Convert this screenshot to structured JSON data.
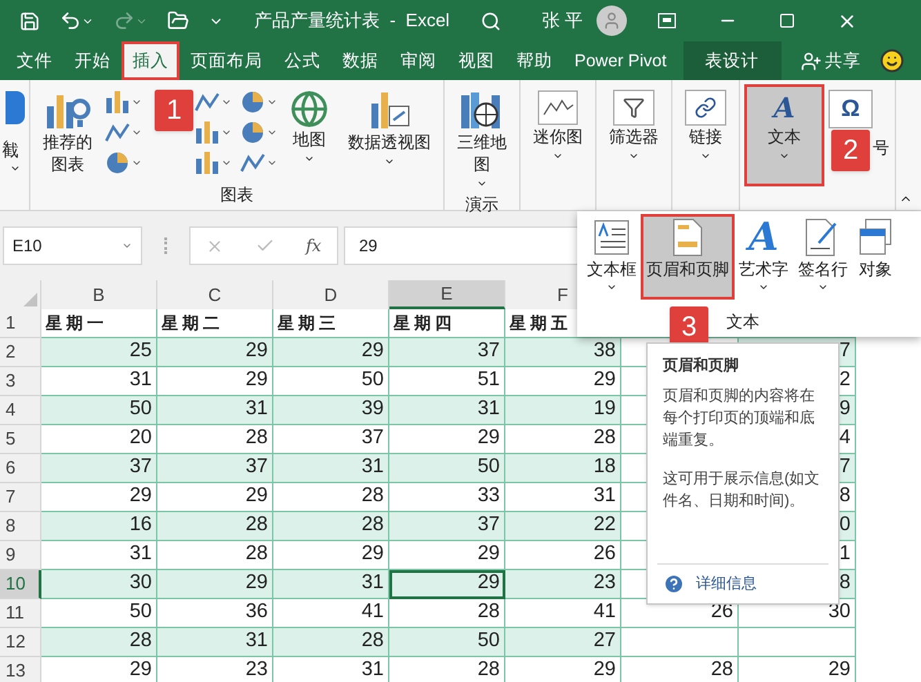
{
  "title_bar": {
    "title": "产品产量统计表  -  Excel",
    "user": "张 平",
    "quick_access": [
      {
        "kind": "save",
        "disabled": false
      },
      {
        "kind": "undo",
        "disabled": false
      },
      {
        "kind": "redo",
        "disabled": true
      },
      {
        "kind": "open",
        "disabled": false
      },
      {
        "kind": "customize",
        "disabled": false
      }
    ]
  },
  "menu_tabs": [
    {
      "label": "文件",
      "selected": false
    },
    {
      "label": "开始",
      "selected": false
    },
    {
      "label": "插入",
      "selected": true,
      "step": "1"
    },
    {
      "label": "页面布局",
      "selected": false
    },
    {
      "label": "公式",
      "selected": false
    },
    {
      "label": "数据",
      "selected": false
    },
    {
      "label": "审阅",
      "selected": false
    },
    {
      "label": "视图",
      "selected": false
    },
    {
      "label": "帮助",
      "selected": false
    },
    {
      "label": "Power Pivot",
      "selected": false
    },
    {
      "label": "表设计",
      "selected": false,
      "kind": "contextual"
    }
  ],
  "share": "共享",
  "ribbon": {
    "cut_item": "截",
    "groups": [
      {
        "label": "图表",
        "buttons": [
          {
            "kind": "recommended",
            "lines": [
              "推荐的",
              "图表"
            ],
            "pressed": false
          },
          {
            "kind": "chart_grid",
            "pressed": false
          },
          {
            "kind": "map",
            "lines": [
              "地图"
            ],
            "pressed": false
          },
          {
            "kind": "pivot",
            "lines": [
              "数据透视图"
            ],
            "pressed": false
          }
        ]
      },
      {
        "label": "演示",
        "buttons": [
          {
            "kind": "map3d",
            "lines": [
              "三维地",
              "图"
            ],
            "pressed": false
          }
        ]
      },
      {
        "buttons": [
          {
            "kind": "sparkline",
            "lines": [
              "迷你图"
            ],
            "pressed": false
          }
        ]
      },
      {
        "buttons": [
          {
            "kind": "filter",
            "lines": [
              "筛选器"
            ],
            "pressed": false
          }
        ]
      },
      {
        "buttons": [
          {
            "kind": "link",
            "lines": [
              "链接"
            ],
            "pressed": false
          }
        ]
      },
      {
        "buttons": [
          {
            "kind": "text",
            "glyph": "A",
            "lines": [
              "文本"
            ],
            "pressed": true,
            "step": "2"
          },
          {
            "kind": "symbol",
            "glyph": "Ω",
            "lines": [
              "号"
            ],
            "pressed": false
          }
        ]
      }
    ]
  },
  "text_menu": {
    "label": "文本",
    "buttons": [
      {
        "kind": "textbox",
        "label": "文本框",
        "pressed": false
      },
      {
        "kind": "header",
        "label": "页眉和页脚",
        "pressed": true,
        "step": "3"
      },
      {
        "kind": "wordart",
        "glyph": "A",
        "label": "艺术字",
        "pressed": false
      },
      {
        "kind": "signature",
        "label": "签名行",
        "pressed": false
      },
      {
        "kind": "object",
        "label": "对象",
        "pressed": false
      }
    ]
  },
  "tooltip": {
    "title": "页眉和页脚",
    "paragraphs": [
      "页眉和页脚的内容将在每个打印页的顶端和底端重复。",
      "这可用于展示信息(如文件名、日期和时间)。"
    ],
    "link": "详细信息"
  },
  "formula_bar": {
    "name_box": "E10",
    "function_label": "fx",
    "value": "29"
  },
  "sheet": {
    "columns": [
      {
        "label": "B",
        "selected": false
      },
      {
        "label": "C",
        "selected": false
      },
      {
        "label": "D",
        "selected": false
      },
      {
        "label": "E",
        "selected": true
      },
      {
        "label": "F",
        "selected": false
      }
    ],
    "rows": [
      {
        "label": "1",
        "selected": false,
        "cells": [
          "星期一",
          "星期二",
          "星期三",
          "星期四",
          "星期五",
          null,
          null
        ]
      },
      {
        "label": "2",
        "selected": false,
        "cells": [
          "25",
          "29",
          "29",
          "37",
          "38",
          null,
          "7"
        ]
      },
      {
        "label": "3",
        "selected": false,
        "cells": [
          "31",
          "29",
          "50",
          "51",
          "29",
          null,
          "2"
        ]
      },
      {
        "label": "4",
        "selected": false,
        "cells": [
          "50",
          "31",
          "39",
          "31",
          "19",
          null,
          "9"
        ]
      },
      {
        "label": "5",
        "selected": false,
        "cells": [
          "20",
          "28",
          "37",
          "29",
          "28",
          null,
          "4"
        ]
      },
      {
        "label": "6",
        "selected": false,
        "cells": [
          "37",
          "37",
          "31",
          "50",
          "18",
          null,
          "7"
        ]
      },
      {
        "label": "7",
        "selected": false,
        "cells": [
          "29",
          "29",
          "28",
          "33",
          "31",
          null,
          "8"
        ]
      },
      {
        "label": "8",
        "selected": false,
        "cells": [
          "16",
          "28",
          "28",
          "37",
          "22",
          null,
          "0"
        ]
      },
      {
        "label": "9",
        "selected": false,
        "cells": [
          "31",
          "28",
          "29",
          "29",
          "26",
          null,
          "1"
        ]
      },
      {
        "label": "10",
        "selected": true,
        "cells": [
          "30",
          "29",
          "31",
          "29",
          "23",
          null,
          "8"
        ]
      },
      {
        "label": "11",
        "selected": false,
        "cells": [
          "50",
          "36",
          "41",
          "28",
          "41",
          "26",
          "30"
        ]
      },
      {
        "label": "12",
        "selected": false,
        "cells": [
          "28",
          "31",
          "28",
          "50",
          "27",
          null,
          null
        ]
      },
      {
        "label": "13",
        "selected": false,
        "cells": [
          "29",
          "23",
          "31",
          "28",
          "29",
          "28",
          "29"
        ]
      }
    ]
  }
}
